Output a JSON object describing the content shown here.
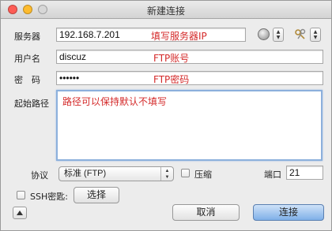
{
  "window": {
    "title": "新建连接",
    "traffic_colors": {
      "close": "#fd5c55",
      "minimize": "#fdbb2e",
      "zoom": "#d7d7d7"
    }
  },
  "server": {
    "label": "服务器",
    "value": "192.168.7.201",
    "annotation": "填写服务器IP"
  },
  "user": {
    "label": "用户名",
    "value": "discuz",
    "annotation": "FTP账号"
  },
  "password": {
    "label": "密　码",
    "value": "••••••",
    "annotation": "FTP密码"
  },
  "path": {
    "label": "起始路径",
    "value": "",
    "annotation": "路径可以保持默认不填写"
  },
  "protocol": {
    "label": "协议",
    "selected": "标准 (FTP)"
  },
  "compress": {
    "label": "压缩",
    "checked": false
  },
  "port": {
    "label": "端口",
    "value": "21"
  },
  "ssh": {
    "label": "SSH密匙:",
    "checked": false,
    "choose_label": "选择"
  },
  "actions": {
    "cancel_label": "取消",
    "connect_label": "连接"
  },
  "icons": {
    "globe": "globe-icon",
    "keys": "keys-icon",
    "disclosure": "triangle-up-icon"
  },
  "colors": {
    "annotation": "#d42a2a",
    "focus_ring": "#8cb0dc",
    "default_button": "#7fb0e8"
  }
}
